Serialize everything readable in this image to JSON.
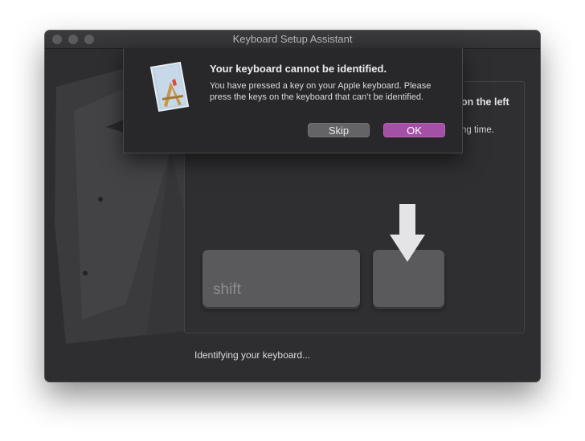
{
  "window": {
    "title": "Keyboard Setup Assistant"
  },
  "panel": {
    "heading_fragment": "on the left",
    "body_fragment": "ng time."
  },
  "keyboard": {
    "shift_label": "shift"
  },
  "status": {
    "text": "Identifying your keyboard..."
  },
  "alert": {
    "title": "Your keyboard cannot be identified.",
    "message": "You have pressed a key on your Apple keyboard. Please press the keys on the keyboard that can’t be identified.",
    "buttons": {
      "skip": "Skip",
      "ok": "OK"
    },
    "icon": "keyboard-setup-app-icon"
  },
  "colors": {
    "accent": "#a550a7",
    "window_bg": "#2e2e30",
    "alert_bg": "#28282a"
  }
}
